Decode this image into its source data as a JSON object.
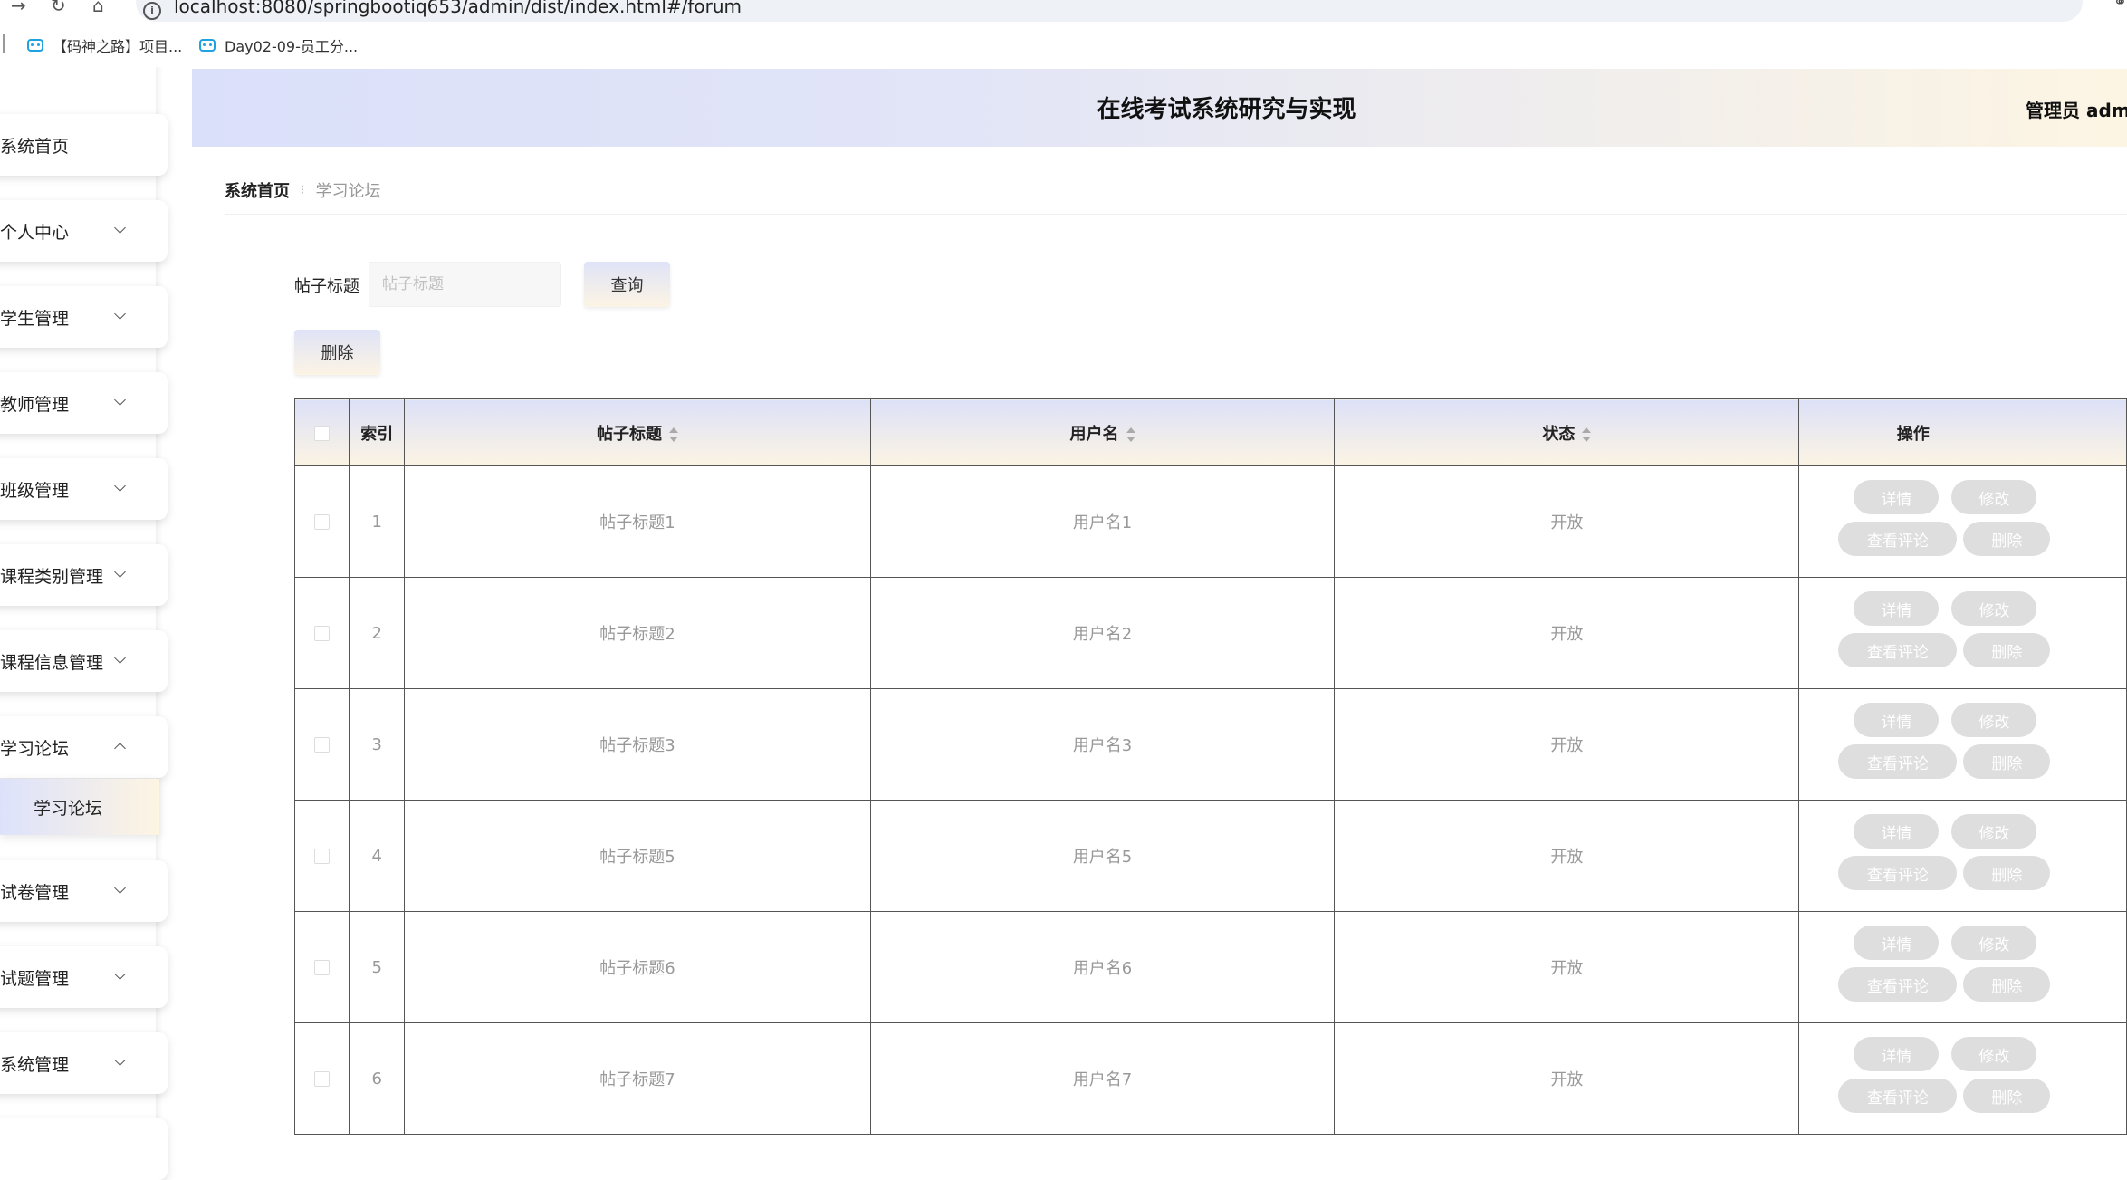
{
  "browser": {
    "url": "localhost:8080/springbootiq653/admin/dist/index.html#/forum",
    "bookmarks": [
      {
        "label": "【码神之路】项目..."
      },
      {
        "label": "Day02-09-员工分..."
      }
    ]
  },
  "header": {
    "title": "在线考试系统研究与实现",
    "user": "管理员 adm"
  },
  "sidebar": {
    "items": [
      {
        "label": "系统首页"
      },
      {
        "label": "个人中心"
      },
      {
        "label": "学生管理"
      },
      {
        "label": "教师管理"
      },
      {
        "label": "班级管理"
      },
      {
        "label": "课程类别管理"
      },
      {
        "label": "课程信息管理"
      },
      {
        "label": "学习论坛"
      },
      {
        "label": "试卷管理"
      },
      {
        "label": "试题管理"
      },
      {
        "label": "系统管理"
      }
    ],
    "submenu": {
      "label": "学习论坛"
    }
  },
  "breadcrumb": {
    "home": "系统首页",
    "current": "学习论坛"
  },
  "search": {
    "label": "帖子标题",
    "placeholder": "帖子标题",
    "query_button": "查询",
    "delete_button": "删除"
  },
  "table": {
    "headers": {
      "index": "索引",
      "title": "帖子标题",
      "username": "用户名",
      "status": "状态",
      "actions": "操作"
    },
    "action_labels": {
      "detail": "详情",
      "edit": "修改",
      "comments": "查看评论",
      "delete": "删除"
    },
    "rows": [
      {
        "index": "1",
        "title": "帖子标题1",
        "username": "用户名1",
        "status": "开放"
      },
      {
        "index": "2",
        "title": "帖子标题2",
        "username": "用户名2",
        "status": "开放"
      },
      {
        "index": "3",
        "title": "帖子标题3",
        "username": "用户名3",
        "status": "开放"
      },
      {
        "index": "4",
        "title": "帖子标题5",
        "username": "用户名5",
        "status": "开放"
      },
      {
        "index": "5",
        "title": "帖子标题6",
        "username": "用户名6",
        "status": "开放"
      },
      {
        "index": "6",
        "title": "帖子标题7",
        "username": "用户名7",
        "status": "开放"
      }
    ]
  }
}
